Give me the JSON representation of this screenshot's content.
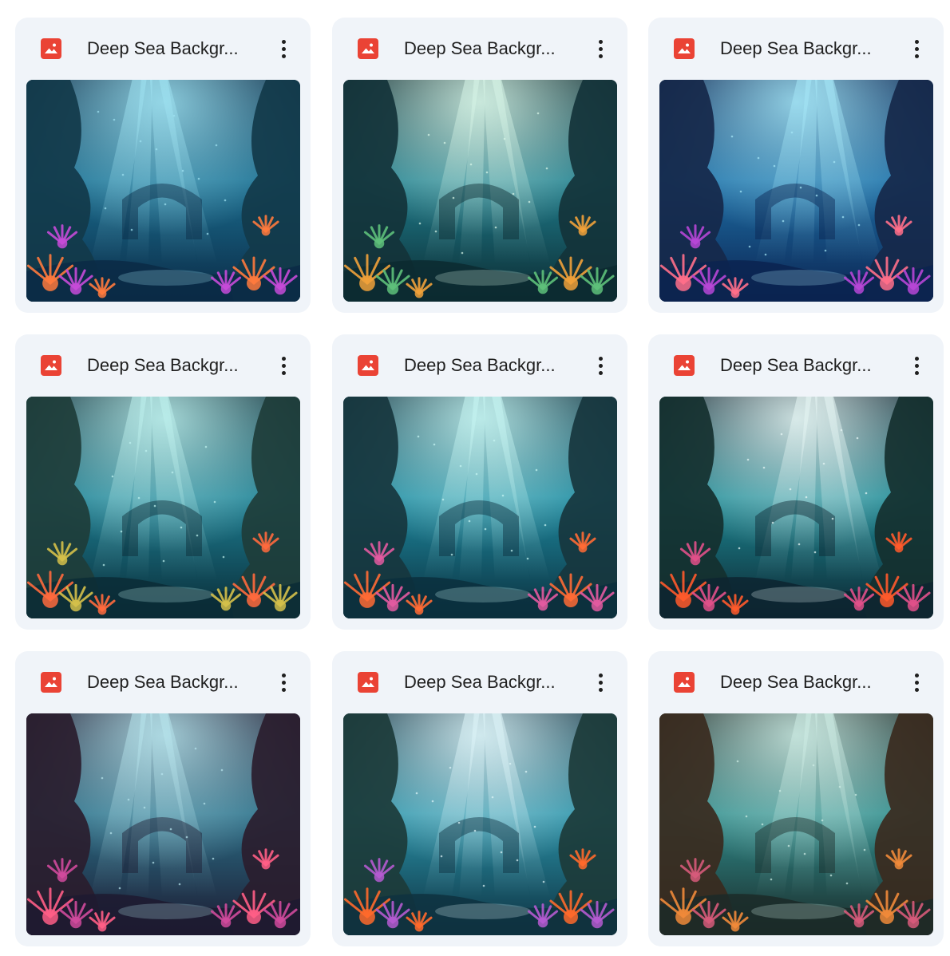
{
  "files": [
    {
      "title": "Deep Sea Backgr...",
      "icon": "image-file-icon",
      "palette": {
        "water": "#1a6d8f",
        "deep": "#0b2a45",
        "light": "#9fe3f2",
        "coral1": "#ff7a3d",
        "coral2": "#c64bd8",
        "rock": "#123a4a"
      }
    },
    {
      "title": "Deep Sea Backgr...",
      "icon": "image-file-icon",
      "palette": {
        "water": "#1f7e8e",
        "deep": "#0c2a30",
        "light": "#d8f6e8",
        "coral1": "#f0a13a",
        "coral2": "#5ec07a",
        "rock": "#14333a"
      }
    },
    {
      "title": "Deep Sea Backgr...",
      "icon": "image-file-icon",
      "palette": {
        "water": "#1e6fa6",
        "deep": "#0b2350",
        "light": "#a6e8f8",
        "coral1": "#ff6f8a",
        "coral2": "#b646d6",
        "rock": "#16284a"
      }
    },
    {
      "title": "Deep Sea Backgr...",
      "icon": "image-file-icon",
      "palette": {
        "water": "#1d7f93",
        "deep": "#0a2b36",
        "light": "#bff2ef",
        "coral1": "#ff6a3d",
        "coral2": "#d4c04a",
        "rock": "#1e3d3a"
      }
    },
    {
      "title": "Deep Sea Backgr...",
      "icon": "image-file-icon",
      "palette": {
        "water": "#1e8aa0",
        "deep": "#0b2f3d",
        "light": "#c8f7f4",
        "coral1": "#ff6b35",
        "coral2": "#e25aa0",
        "rock": "#17363e"
      }
    },
    {
      "title": "Deep Sea Backgr...",
      "icon": "image-file-icon",
      "palette": {
        "water": "#1d8a95",
        "deep": "#0d2530",
        "light": "#e8f8f6",
        "coral1": "#ff5a2c",
        "coral2": "#e0508a",
        "rock": "#15302f"
      }
    },
    {
      "title": "Deep Sea Backgr...",
      "icon": "image-file-icon",
      "palette": {
        "water": "#2a6d86",
        "deep": "#1d1a30",
        "light": "#b8e6ee",
        "coral1": "#ff5e86",
        "coral2": "#d04a9c",
        "rock": "#2a1d2e"
      }
    },
    {
      "title": "Deep Sea Backgr...",
      "icon": "image-file-icon",
      "palette": {
        "water": "#2a92a8",
        "deep": "#0e3140",
        "light": "#dff6fa",
        "coral1": "#ff6a2c",
        "coral2": "#b45ad0",
        "rock": "#1c3b3a"
      }
    },
    {
      "title": "Deep Sea Backgr...",
      "icon": "image-file-icon",
      "palette": {
        "water": "#2f8c8c",
        "deep": "#1b2a28",
        "light": "#cfeee6",
        "coral1": "#f08a3a",
        "coral2": "#d65a7a",
        "rock": "#3a2a1e"
      }
    }
  ],
  "colors": {
    "card_bg": "#f0f4f9",
    "icon_red": "#ea4335",
    "text": "#1f1f1f"
  }
}
